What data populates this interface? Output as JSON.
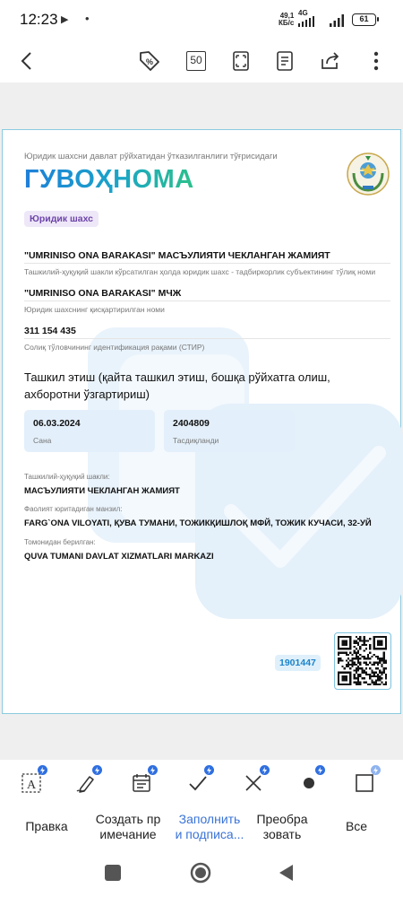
{
  "status_bar": {
    "time": "12:23",
    "speed_value": "49,1",
    "speed_unit": "КБ/с",
    "network": "4G",
    "battery": "61"
  },
  "toolbar": {
    "page_count": "50"
  },
  "document": {
    "subtitle": "Юридик шахсни давлат рўйхатидан ўтказилганлиги тўғрисидаги",
    "title": "ГУВОҲНОМА",
    "entity_type": "Юридик шахс",
    "full_name": "\"UMRINISO ONA BARAKASI\" МАСЪУЛИЯТИ ЧЕКЛАНГАН ЖАМИЯТ",
    "full_name_label": "Ташкилий-ҳуқуқий шакли кўрсатилган ҳолда юридик шахс - тадбиркорлик субъектининг тўлиқ номи",
    "short_name": "\"UMRINISO ONA BARAKASI\" МЧЖ",
    "short_name_label": "Юридик шахснинг қисқартирилган номи",
    "tin": "311 154 435",
    "tin_label": "Солиқ тўловчининг идентификация рақами (СТИР)",
    "section_title": "Ташкил этиш (қайта ташкил этиш, бошқа рўйхатга олиш, ахборотни ўзгартириш)",
    "date_value": "06.03.2024",
    "date_label": "Сана",
    "number_value": "2404809",
    "number_label": "Тасдиқланди",
    "legal_form_label": "Ташкилий-ҳуқуқий шакли:",
    "legal_form": "МАСЪУЛИЯТИ ЧЕКЛАНГАН ЖАМИЯТ",
    "address_label": "Фаолият юритадиган манзил:",
    "address": "FARG`ONA VILOYATI, ҚУВА ТУМАНИ, ТОЖИКҚИШЛОҚ МФЙ, ТОЖИК КУЧАСИ, 32-УЙ",
    "issuer_label": "Томонидан берилган:",
    "issuer": "QUVA TUMANI DAVLAT XIZMATLARI MARKAZI",
    "reg_number": "1901447"
  },
  "bottom_tabs": [
    {
      "label": "Правка"
    },
    {
      "label": "Создать пр\nимечание"
    },
    {
      "label": "Заполнить\nи подписа..."
    },
    {
      "label": "Преобра\nзовать"
    },
    {
      "label": "Все"
    }
  ],
  "colors": {
    "accent": "#3a73d8",
    "title_gradient_start": "#1e7fd8",
    "title_gradient_end": "#2cc08a",
    "badge_purple": "#6d45a8",
    "doc_border": "#8ccbdf"
  }
}
